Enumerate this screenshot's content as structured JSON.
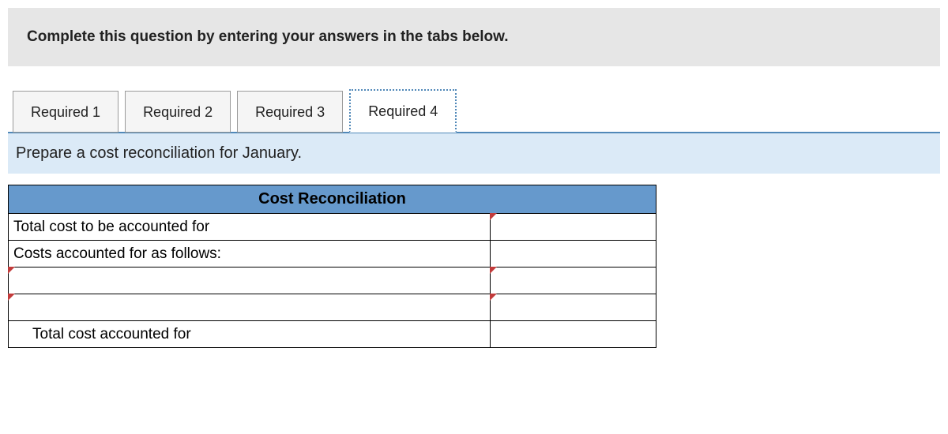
{
  "instruction": "Complete this question by entering your answers in the tabs below.",
  "tabs": [
    {
      "label": "Required 1",
      "active": false
    },
    {
      "label": "Required 2",
      "active": false
    },
    {
      "label": "Required 3",
      "active": false
    },
    {
      "label": "Required 4",
      "active": true
    }
  ],
  "prompt": "Prepare a cost reconciliation for January.",
  "table": {
    "header": "Cost Reconciliation",
    "rows": [
      {
        "label": "Total cost to be accounted for",
        "value": "",
        "label_input": false,
        "value_input": true,
        "indent": false
      },
      {
        "label": "Costs accounted for as follows:",
        "value": "",
        "label_input": false,
        "value_input": false,
        "indent": false
      },
      {
        "label": "",
        "value": "",
        "label_input": true,
        "value_input": true,
        "indent": false
      },
      {
        "label": "",
        "value": "",
        "label_input": true,
        "value_input": true,
        "indent": false
      },
      {
        "label": "Total cost accounted for",
        "value": "",
        "label_input": false,
        "value_input": false,
        "indent": true
      }
    ]
  }
}
